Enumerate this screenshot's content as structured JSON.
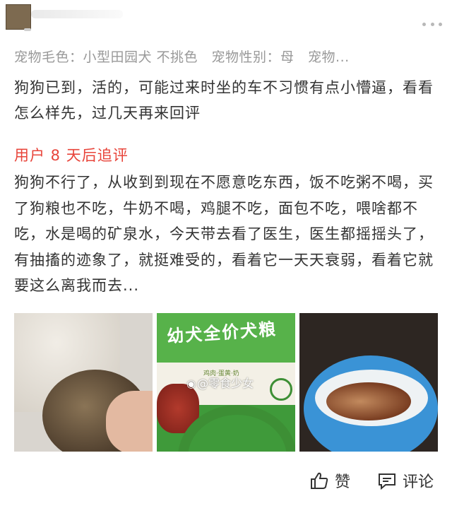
{
  "attributes": "宠物毛色：小型田园犬 不挑色　宠物性别：母　宠物...",
  "review": "狗狗已到，活的，可能过来时坐的车不习惯有点小懵逼，看看怎么样先，过几天再来回评",
  "followup": {
    "title": "用户 8 天后追评",
    "text": "狗狗不行了，从收到到现在不愿意吃东西，饭不吃粥不喝，买了狗粮也不吃，牛奶不喝，鸡腿不吃，面包不吃，喂啥都不吃，水是喝的矿泉水，今天带去看了医生，医生都摇摇头了，有抽搐的迹象了，就挺难受的，看着它一天天衰弱，看着它就要这么离我而去..."
  },
  "photos": {
    "bag_title": "幼犬全价犬粮",
    "bag_sub": "鸡肉·蛋黄·奶",
    "watermark": "@零食少女"
  },
  "actions": {
    "like_label": "赞",
    "comment_label": "评论"
  },
  "icons": {
    "more": "more-dots-icon",
    "like": "thumbs-up-icon",
    "comment": "comment-icon",
    "watermark": "weibo-icon"
  },
  "colors": {
    "followup_accent": "#e8443a",
    "muted_text": "#999999",
    "body_text": "#333333"
  }
}
